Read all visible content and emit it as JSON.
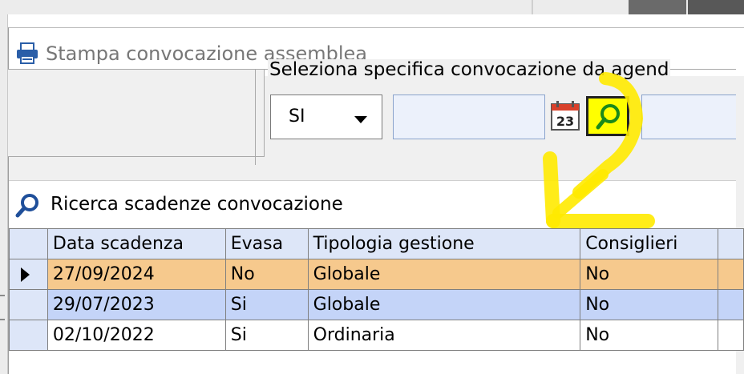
{
  "window": {
    "title": "Stampa convocazione assemblea"
  },
  "filter": {
    "group_label": "Seleziona specifica convocazione da agend",
    "combo_value": "SI",
    "date_value": "",
    "right_value": "",
    "calendar_day": "23"
  },
  "search_panel": {
    "title": "Ricerca scadenze convocazione",
    "columns": [
      "Data scadenza",
      "Evasa",
      "Tipologia gestione",
      "Consiglieri"
    ],
    "rows": [
      {
        "data_scadenza": "27/09/2024",
        "evasa": "No",
        "tipologia_gestione": "Globale",
        "consiglieri": "No"
      },
      {
        "data_scadenza": "29/07/2023",
        "evasa": "Si",
        "tipologia_gestione": "Globale",
        "consiglieri": "No"
      },
      {
        "data_scadenza": "02/10/2022",
        "evasa": "Si",
        "tipologia_gestione": "Ordinaria",
        "consiglieri": "No"
      }
    ]
  },
  "colors": {
    "current_row": "#f6c98d",
    "selected_row": "#c4d4f8",
    "header": "#dde6f8",
    "highlight": "#ffff00"
  },
  "icons": [
    "printer-icon",
    "calendar-icon",
    "search-icon",
    "row-pointer-icon"
  ]
}
